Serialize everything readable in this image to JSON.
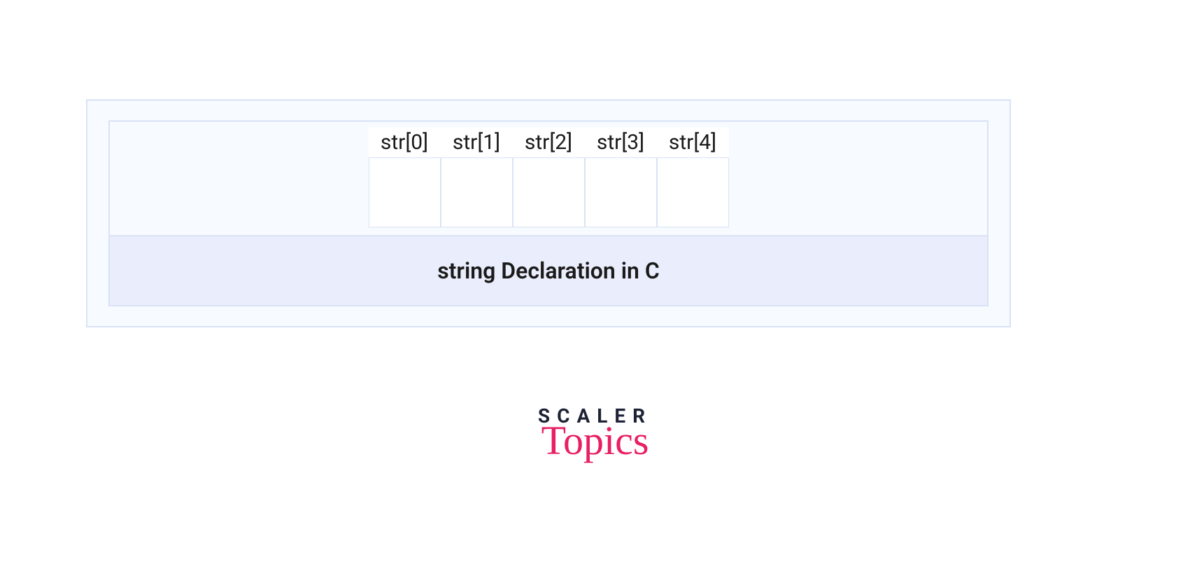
{
  "array": {
    "labels": [
      "str[0]",
      "str[1]",
      "str[2]",
      "str[3]",
      "str[4]"
    ]
  },
  "caption": "string Declaration in C",
  "logo": {
    "line1": "SCALER",
    "line2": "Topics"
  }
}
